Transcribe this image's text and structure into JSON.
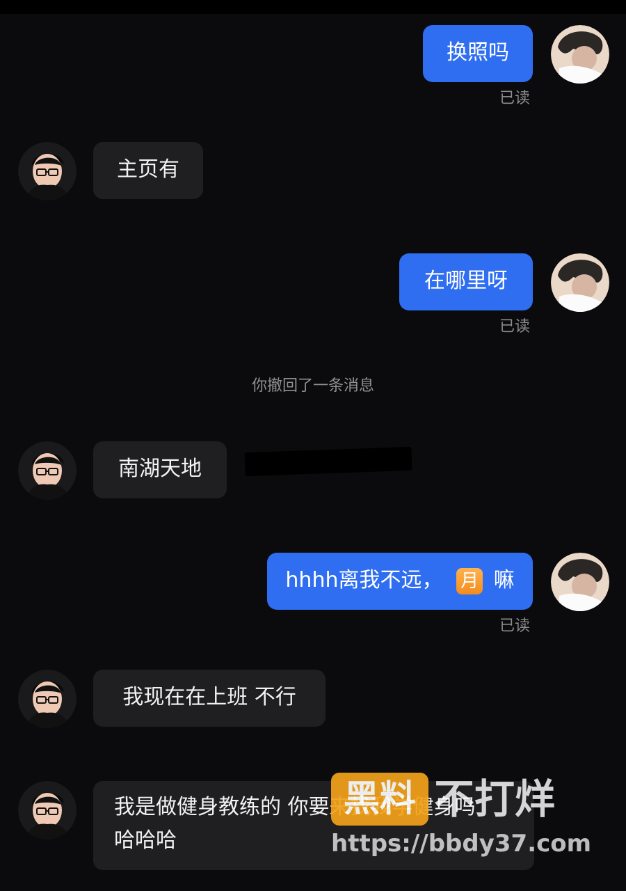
{
  "messages": [
    {
      "id": "m1",
      "direction": "outgoing",
      "text": "换照吗",
      "status": "已读"
    },
    {
      "id": "m2",
      "direction": "incoming",
      "text": "主页有"
    },
    {
      "id": "m3",
      "direction": "outgoing",
      "text": "在哪里呀",
      "status": "已读"
    },
    {
      "id": "m4",
      "direction": "incoming",
      "text": "南湖天地"
    },
    {
      "id": "m5",
      "direction": "outgoing",
      "text_before_emoji": "hhhh离我不远，",
      "emoji": "月",
      "text_after_emoji": "嘛",
      "status": "已读"
    },
    {
      "id": "m6",
      "direction": "incoming",
      "text": "我现在在上班 不行"
    },
    {
      "id": "m7",
      "direction": "incoming",
      "line1": "我是做健身教练的 你要来找我学健身吗",
      "line2": "哈哈哈"
    }
  ],
  "system": {
    "recall_notice": "你撤回了一条消息"
  },
  "watermark": {
    "box_text": "黑料",
    "text": "不打烊",
    "url": "https://bbdy37.com"
  },
  "colors": {
    "background": "#0b0b0d",
    "outgoing_bubble": "#2f6ef0",
    "incoming_bubble": "#1f1f22",
    "read_receipt": "#8c8c8c"
  },
  "icons": {
    "self_avatar": "curly-hair-person-avatar-icon",
    "contact_avatar": "glasses-man-avatar-icon"
  }
}
